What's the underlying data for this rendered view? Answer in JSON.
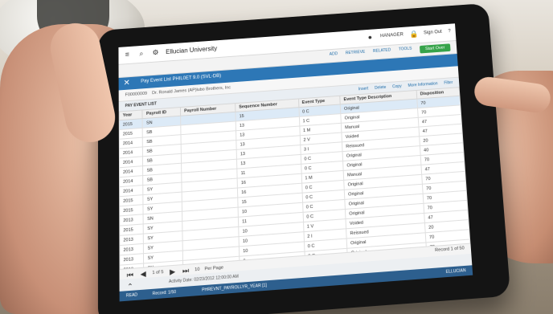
{
  "app": {
    "brand": "Ellucian University",
    "user": "HANAGER",
    "sign_out": "Sign Out",
    "help": "?"
  },
  "actions": {
    "add": "ADD",
    "retrieve": "RETRIEVE",
    "related": "RELATED",
    "tools": "TOOLS",
    "start_over": "Start Over"
  },
  "page": {
    "title": "Pay Event List PHIL0ET 9.0 (SVL-DB)",
    "key_id": "F00000009",
    "key_name": "Dr. Ronald James (AP)lubo Brothers, Inc"
  },
  "section": {
    "header": "PAY EVENT LIST",
    "insert": "Insert",
    "delete": "Delete",
    "copy": "Copy",
    "more_info": "More Information",
    "filter": "Filter"
  },
  "grid": {
    "columns": [
      "Year",
      "Payroll ID",
      "Payroll Number",
      "Sequence Number",
      "Event Type",
      "Event Type Description",
      "Disposition"
    ],
    "rows": [
      [
        "2015",
        "SN",
        "",
        "15",
        "0 C",
        "Original",
        "70"
      ],
      [
        "2015",
        "SB",
        "",
        "13",
        "1 C",
        "Original",
        "70"
      ],
      [
        "2014",
        "SB",
        "",
        "13",
        "1 M",
        "Manual",
        "47"
      ],
      [
        "2014",
        "SB",
        "",
        "13",
        "2 V",
        "Voided",
        "47"
      ],
      [
        "2014",
        "SB",
        "",
        "13",
        "3 I",
        "Reissued",
        "20"
      ],
      [
        "2014",
        "SB",
        "",
        "13",
        "0 C",
        "Original",
        "40"
      ],
      [
        "2014",
        "SB",
        "",
        "11",
        "0 C",
        "Original",
        "70"
      ],
      [
        "2014",
        "SY",
        "",
        "16",
        "1 M",
        "Manual",
        "47"
      ],
      [
        "2015",
        "SY",
        "",
        "16",
        "0 C",
        "Original",
        "70"
      ],
      [
        "2015",
        "SY",
        "",
        "15",
        "0 C",
        "Original",
        "70"
      ],
      [
        "2013",
        "SN",
        "",
        "10",
        "0 C",
        "Original",
        "70"
      ],
      [
        "2015",
        "SY",
        "",
        "11",
        "0 C",
        "Original",
        "70"
      ],
      [
        "2013",
        "SY",
        "",
        "10",
        "1 V",
        "Voided",
        "47"
      ],
      [
        "2013",
        "SY",
        "",
        "10",
        "2 I",
        "Reissued",
        "20"
      ],
      [
        "2013",
        "SY",
        "",
        "10",
        "0 C",
        "Original",
        "70"
      ],
      [
        "2013",
        "SY",
        "",
        "9",
        "0 C",
        "Original",
        "70"
      ],
      [
        "2013",
        "SY",
        "",
        "8",
        "0 C",
        "Original",
        "70"
      ],
      [
        "2013",
        "SY",
        "",
        "7",
        "",
        "",
        ""
      ],
      [
        "2013",
        "SY",
        "",
        "",
        "",
        "",
        ""
      ]
    ]
  },
  "pager": {
    "page_text": "1 of 5",
    "per_page_value": "10",
    "per_page_label": "Per Page",
    "record": "Record 1 of 50"
  },
  "activity": {
    "label": "Activity Date: 02/23/2012 12:00:00 AM"
  },
  "status": {
    "left": "READ",
    "record": "Record: 1/50",
    "field": "PHREVNT_PAYROLLYR_YEAR [1]",
    "right": "ELLUCIAN"
  }
}
